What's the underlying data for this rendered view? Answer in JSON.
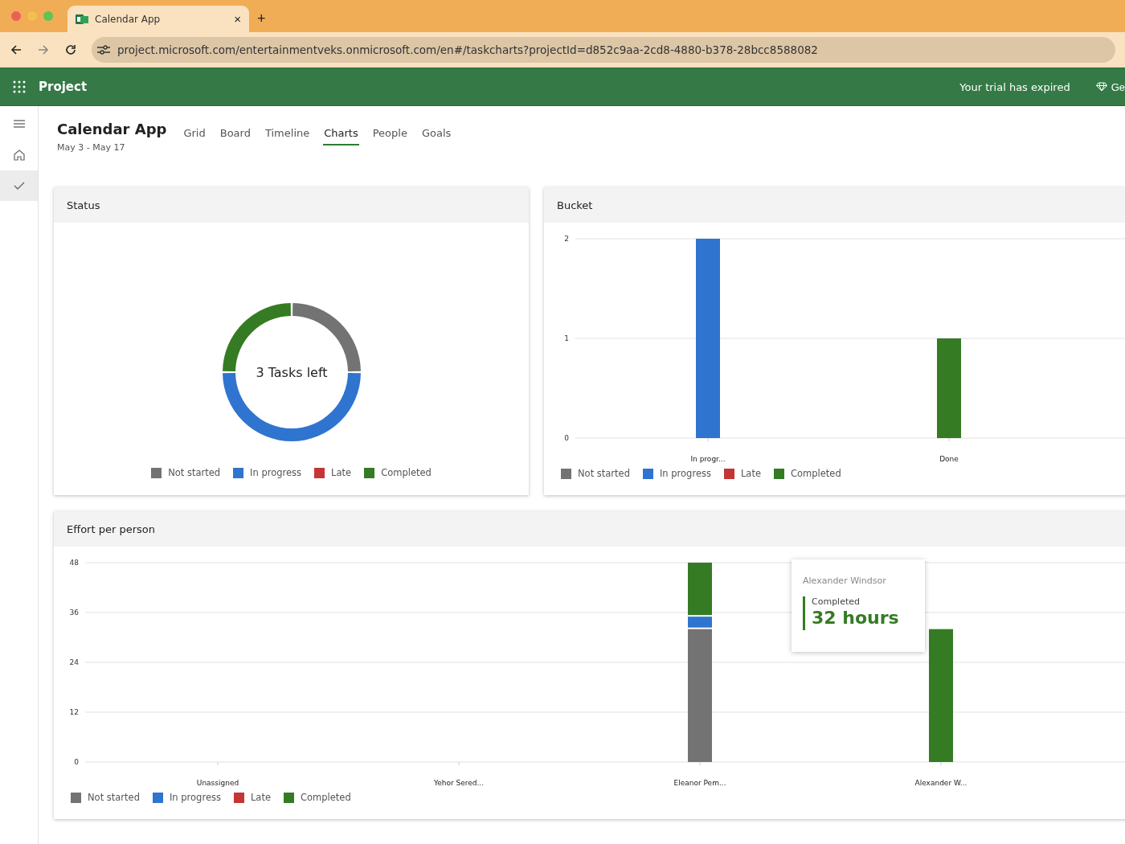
{
  "browser": {
    "tab_title": "Calendar App",
    "close": "×",
    "new_tab": "+",
    "url": "project.microsoft.com/entertainmentveks.onmicrosoft.com/en#/taskcharts?projectId=d852c9aa-2cd8-4880-b378-28bcc8588082"
  },
  "app_bar": {
    "title": "Project",
    "trial_notice": "Your trial has expired",
    "upgrade": "Ge"
  },
  "sidebar": {
    "items": [
      {
        "kind": "menu",
        "selected": false
      },
      {
        "kind": "home",
        "selected": false
      },
      {
        "kind": "tasks",
        "selected": true
      }
    ]
  },
  "project": {
    "title": "Calendar App",
    "dates": "May 3 - May 17"
  },
  "tabs": [
    {
      "label": "Grid",
      "selected": false
    },
    {
      "label": "Board",
      "selected": false
    },
    {
      "label": "Timeline",
      "selected": false
    },
    {
      "label": "Charts",
      "selected": true
    },
    {
      "label": "People",
      "selected": false
    },
    {
      "label": "Goals",
      "selected": false
    }
  ],
  "status_card": {
    "title": "Status",
    "center_text": "3 Tasks left",
    "chart_data": {
      "type": "donut",
      "categories": [
        "Not started",
        "In progress",
        "Late",
        "Completed"
      ],
      "colors": [
        "#737373",
        "#2f74cf",
        "#c43535",
        "#357b24"
      ],
      "values": [
        25,
        50,
        0,
        25
      ]
    }
  },
  "bucket_card": {
    "title": "Bucket",
    "chart_data": {
      "type": "bar",
      "stacked": true,
      "grid": true,
      "categories": [
        "In progr...",
        "Done"
      ],
      "ylim": [
        0,
        2
      ],
      "yticks": [
        0,
        1,
        2
      ],
      "series": [
        {
          "name": "Not started",
          "color": "#737373",
          "values": [
            0,
            0
          ]
        },
        {
          "name": "In progress",
          "color": "#2f74cf",
          "values": [
            2,
            0
          ]
        },
        {
          "name": "Late",
          "color": "#c43535",
          "values": [
            0,
            0
          ]
        },
        {
          "name": "Completed",
          "color": "#357b24",
          "values": [
            0,
            1
          ]
        }
      ]
    }
  },
  "effort_card": {
    "title": "Effort per person",
    "chart_data": {
      "type": "bar",
      "stacked": true,
      "grid": true,
      "categories": [
        "Unassigned",
        "Yehor Sered...",
        "Eleanor Pem...",
        "Alexander W..."
      ],
      "ylim": [
        0,
        48
      ],
      "yticks": [
        0,
        12,
        24,
        36,
        48
      ],
      "series": [
        {
          "name": "Not started",
          "color": "#737373",
          "values": [
            0,
            0,
            32,
            0
          ]
        },
        {
          "name": "In progress",
          "color": "#2f74cf",
          "values": [
            0,
            0,
            3,
            0
          ]
        },
        {
          "name": "Late",
          "color": "#c43535",
          "values": [
            0,
            0,
            0,
            0
          ]
        },
        {
          "name": "Completed",
          "color": "#357b24",
          "values": [
            0,
            0,
            13,
            32
          ]
        }
      ]
    },
    "tooltip": {
      "person": "Alexander Windsor",
      "label": "Completed",
      "value": "32 hours"
    }
  }
}
